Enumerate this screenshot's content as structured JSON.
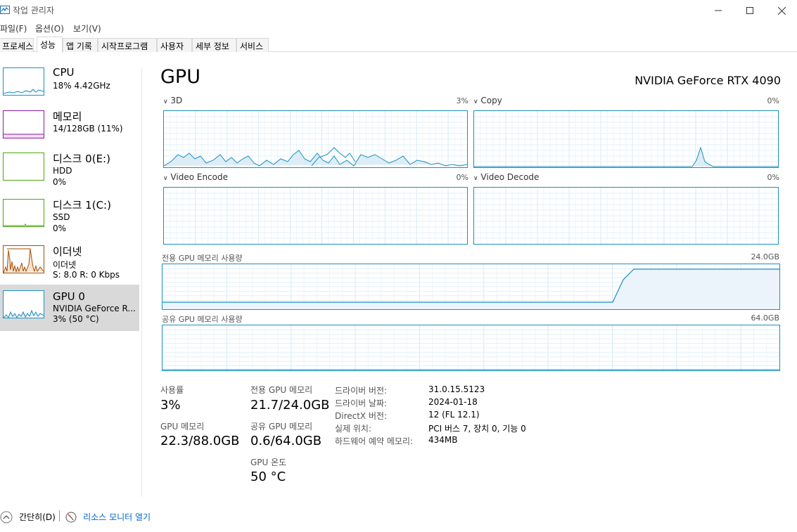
{
  "window": {
    "title": "작업 관리자"
  },
  "menu": [
    "파일(F)",
    "옵션(O)",
    "보기(V)"
  ],
  "tabs": [
    "프로세스",
    "성능",
    "앱 기록",
    "시작프로그램",
    "사용자",
    "세부 정보",
    "서비스"
  ],
  "sidebar": [
    {
      "title": "CPU",
      "l1": "18% 4.42GHz",
      "l2": "",
      "color": "#1a90c2"
    },
    {
      "title": "메모리",
      "l1": "14/128GB (11%)",
      "l2": "",
      "color": "#8b1aa8"
    },
    {
      "title": "디스크 0(E:)",
      "l1": "HDD",
      "l2": "0%",
      "color": "#4da60c"
    },
    {
      "title": "디스크 1(C:)",
      "l1": "SSD",
      "l2": "0%",
      "color": "#4da60c"
    },
    {
      "title": "이더넷",
      "l1": "이더넷",
      "l2": "S: 8.0  R: 0 Kbps",
      "color": "#a74f01"
    },
    {
      "title": "GPU 0",
      "l1": "NVIDIA GeForce R...",
      "l2": "3% (50 °C)",
      "color": "#1a90c2"
    }
  ],
  "main": {
    "title": "GPU",
    "model": "NVIDIA GeForce RTX 4090",
    "engines": [
      {
        "name": "3D",
        "pct": "3%"
      },
      {
        "name": "Copy",
        "pct": "0%"
      },
      {
        "name": "Video Encode",
        "pct": "0%"
      },
      {
        "name": "Video Decode",
        "pct": "0%"
      }
    ],
    "dedicated_mem": {
      "label": "전용 GPU 메모리 사용량",
      "max": "24.0GB"
    },
    "shared_mem": {
      "label": "공유 GPU 메모리 사용량",
      "max": "64.0GB"
    },
    "stats": {
      "usage_label": "사용률",
      "usage": "3%",
      "gpu_mem_label": "GPU 메모리",
      "gpu_mem": "22.3/88.0GB",
      "ded_label": "전용 GPU 메모리",
      "ded": "21.7/24.0GB",
      "shared_label": "공유 GPU 메모리",
      "shared": "0.6/64.0GB",
      "temp_label": "GPU 온도",
      "temp": "50 °C"
    },
    "details": [
      {
        "label": "드라이버 버전:",
        "value": "31.0.15.5123"
      },
      {
        "label": "드라이버 날짜:",
        "value": "2024-01-18"
      },
      {
        "label": "DirectX 버전:",
        "value": "12 (FL 12.1)"
      },
      {
        "label": "실제 위치:",
        "value": "PCI 버스 7, 장치 0, 기능 0"
      },
      {
        "label": "하드웨어 예약 메모리:",
        "value": "434MB"
      }
    ]
  },
  "footer": {
    "less": "간단히(D)",
    "monitor": "리소스 모니터 열기"
  },
  "accent": "#1a90c2"
}
